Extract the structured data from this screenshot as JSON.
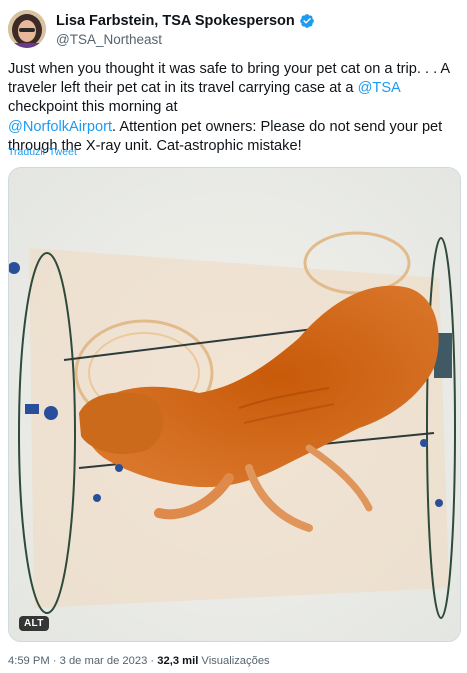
{
  "author": {
    "name": "Lisa Farbstein, TSA Spokesperson",
    "handle": "@TSA_Northeast",
    "verified": true
  },
  "tweet": {
    "text_1": "Just when you thought it was safe to bring your pet cat on a trip. . . A traveler left their pet cat in its travel carrying case at a ",
    "mention_1": "@TSA",
    "text_2": " checkpoint this morning at ",
    "mention_2": "@NorfolkAirport",
    "text_3": ". Attention pet owners: Please do not send your pet through the X-ray unit. Cat-astrophic mistake!",
    "translate_label": "Traduzir Tweet"
  },
  "media": {
    "alt_label": "ALT"
  },
  "meta": {
    "time": "4:59 PM",
    "sep_1": " · ",
    "date": "3 de mar de 2023",
    "sep_2": " · ",
    "views_count": "32,3 mil",
    "views_label": " Visualizações"
  },
  "colors": {
    "accent": "#1d9bf0",
    "text": "#0f1419",
    "secondary": "#536471"
  }
}
